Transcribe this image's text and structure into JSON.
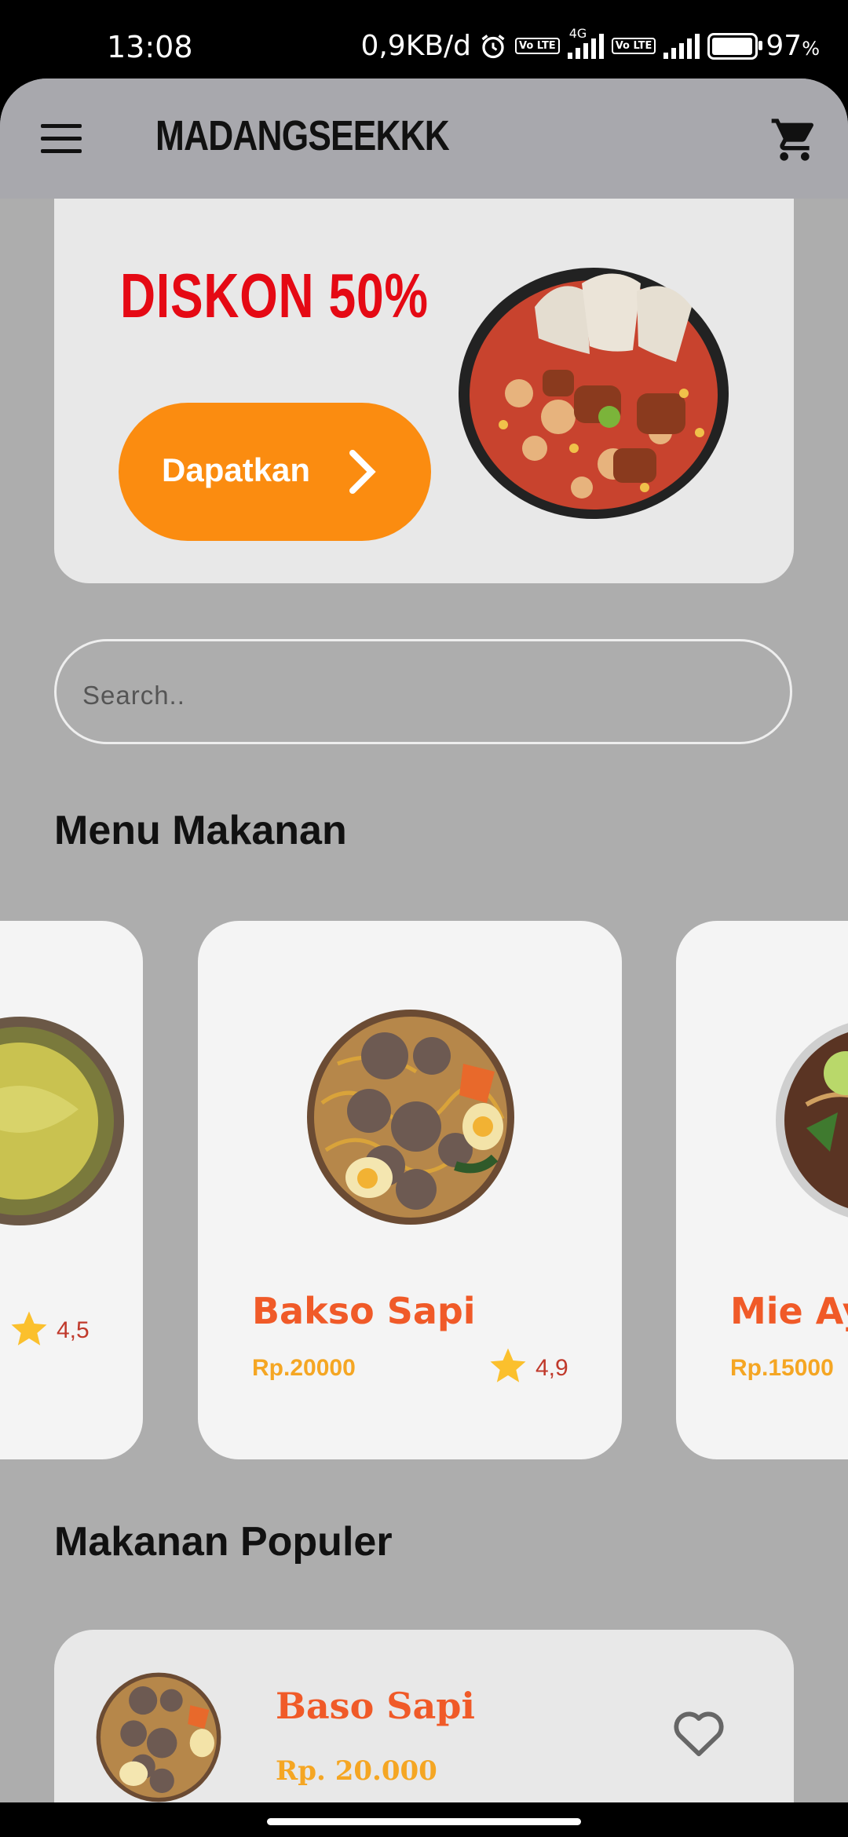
{
  "status_bar": {
    "time": "13:08",
    "net_speed": "0,9KB/d",
    "network_type": "4G",
    "volte_label": "Vo LTE",
    "battery_percent": "97",
    "battery_suffix": "%",
    "battery_level": 0.97
  },
  "app_bar": {
    "brand": "MADANGSEEKKK",
    "menu_icon": "hamburger-menu-icon",
    "cart_icon": "shopping-cart-icon"
  },
  "promo": {
    "title": "DISKON 50%",
    "button_label": "Dapatkan",
    "image": "seblak-bowl-image"
  },
  "search": {
    "placeholder": "Search.."
  },
  "menu_section": {
    "title": "Menu Makanan",
    "items": [
      {
        "name": "",
        "price": "",
        "rating": "4,5",
        "image": "noodle-soup-image"
      },
      {
        "name": "Bakso Sapi",
        "price": "Rp.20000",
        "rating": "4,9",
        "image": "meatball-soup-image"
      },
      {
        "name": "Mie Ay",
        "price": "Rp.15000",
        "rating": "",
        "image": "chicken-noodle-image"
      }
    ]
  },
  "popular_section": {
    "title": "Makanan Populer",
    "items": [
      {
        "name": "Baso Sapi",
        "price": "Rp. 20.000",
        "image": "meatball-soup-image",
        "favorite_icon": "heart-outline-icon"
      }
    ]
  },
  "colors": {
    "accent_orange": "#fb8c10",
    "promo_red": "#e50914",
    "item_name": "#f05a28",
    "price": "#f5a623",
    "star": "#fbc02d",
    "background": "#adadad"
  }
}
